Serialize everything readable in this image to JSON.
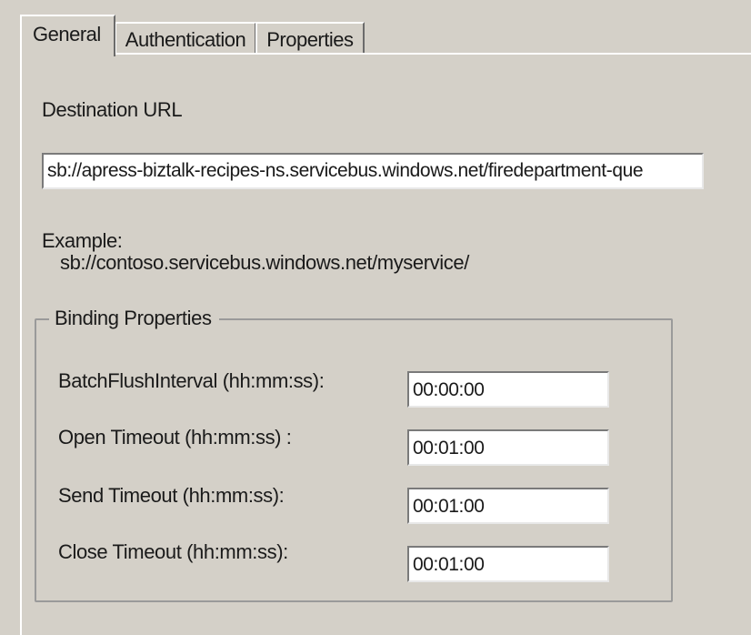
{
  "tabs": [
    {
      "label": "General",
      "active": true
    },
    {
      "label": "Authentication",
      "active": false
    },
    {
      "label": "Properties",
      "active": false
    }
  ],
  "general": {
    "destination_url_label": "Destination URL",
    "destination_url_value": "sb://apress-biztalk-recipes-ns.servicebus.windows.net/firedepartment-que",
    "example_label": "Example:",
    "example_value": "sb://contoso.servicebus.windows.net/myservice/"
  },
  "binding_properties": {
    "title": "Binding Properties",
    "fields": [
      {
        "label": "BatchFlushInterval (hh:mm:ss):",
        "value": "00:00:00"
      },
      {
        "label": "Open Timeout (hh:mm:ss) :",
        "value": "00:01:00"
      },
      {
        "label": "Send Timeout (hh:mm:ss):",
        "value": "00:01:00"
      },
      {
        "label": "Close Timeout (hh:mm:ss):",
        "value": "00:01:00"
      }
    ]
  },
  "colors": {
    "dialog_background": "#d4d0c8",
    "textbox_background": "#ffffff"
  }
}
